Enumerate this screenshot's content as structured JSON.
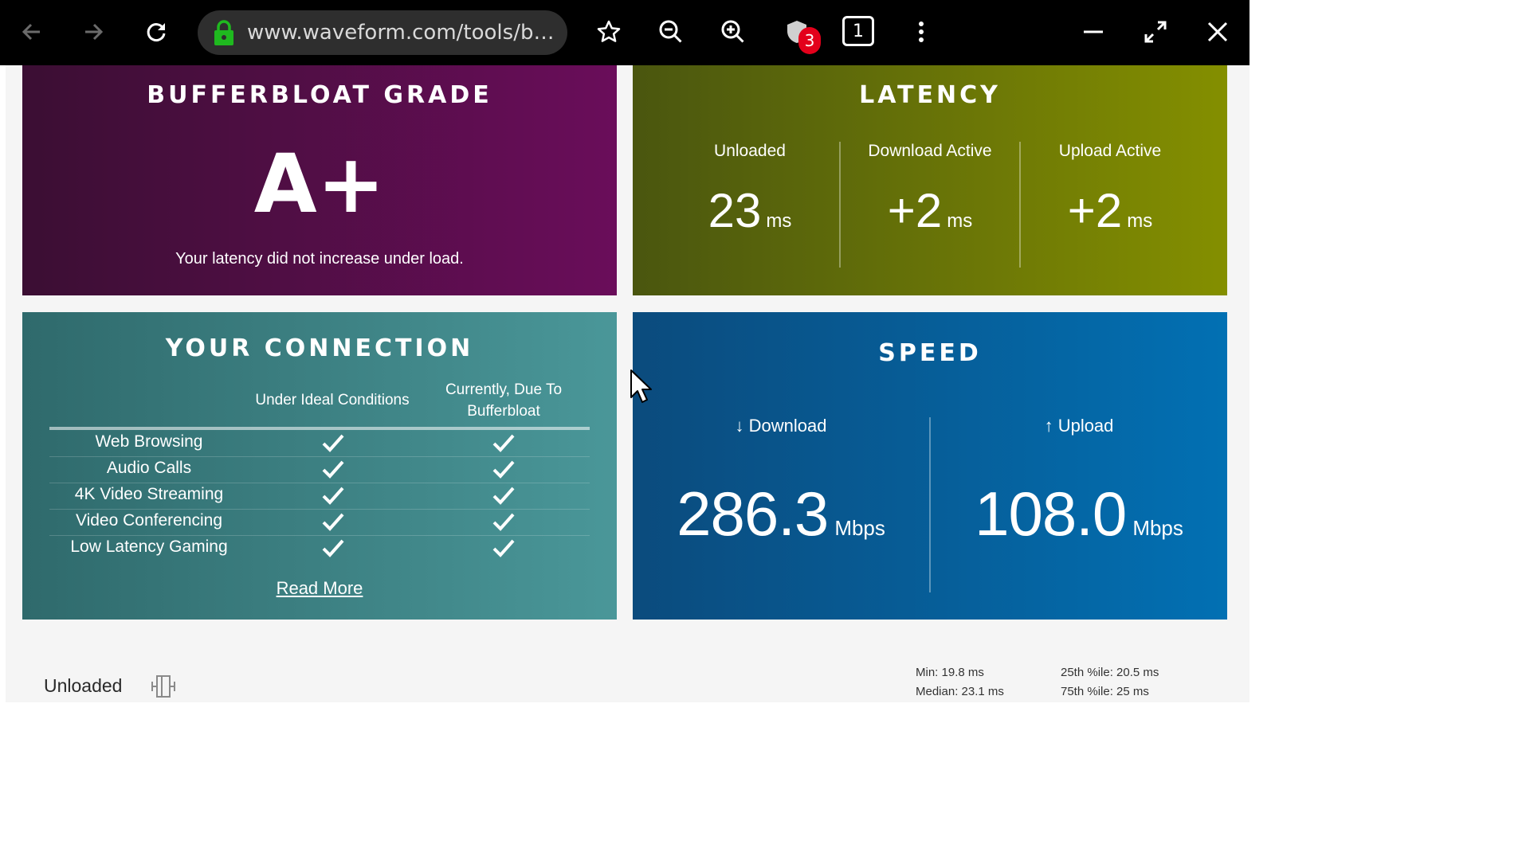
{
  "browser": {
    "url": "www.waveform.com/tools/bu…",
    "shield_badge": "3",
    "tab_count": "1"
  },
  "grade": {
    "title": "BUFFERBLOAT GRADE",
    "value": "A+",
    "note": "Your latency did not increase under load."
  },
  "latency": {
    "title": "LATENCY",
    "columns": [
      {
        "label": "Unloaded",
        "value": "23",
        "unit": "ms"
      },
      {
        "label": "Download Active",
        "value": "+2",
        "unit": "ms"
      },
      {
        "label": "Upload Active",
        "value": "+2",
        "unit": "ms"
      }
    ]
  },
  "connection": {
    "title": "YOUR CONNECTION",
    "header_ideal": "Under Ideal Conditions",
    "header_current": "Currently, Due To Bufferbloat",
    "rows": [
      {
        "label": "Web Browsing",
        "ideal": true,
        "current": true
      },
      {
        "label": "Audio Calls",
        "ideal": true,
        "current": true
      },
      {
        "label": "4K Video Streaming",
        "ideal": true,
        "current": true
      },
      {
        "label": "Video Conferencing",
        "ideal": true,
        "current": true
      },
      {
        "label": "Low Latency Gaming",
        "ideal": true,
        "current": true
      }
    ],
    "read_more": "Read More"
  },
  "speed": {
    "title": "SPEED",
    "download_label": "↓ Download",
    "download_value": "286.3",
    "download_unit": "Mbps",
    "upload_label": "↑ Upload",
    "upload_value": "108.0",
    "upload_unit": "Mbps"
  },
  "unloaded_section": {
    "label": "Unloaded",
    "min": "Min: 19.8 ms",
    "median": "Median: 23.1 ms",
    "p25": "25th %ile: 20.5 ms",
    "p75": "75th %ile: 25 ms"
  }
}
